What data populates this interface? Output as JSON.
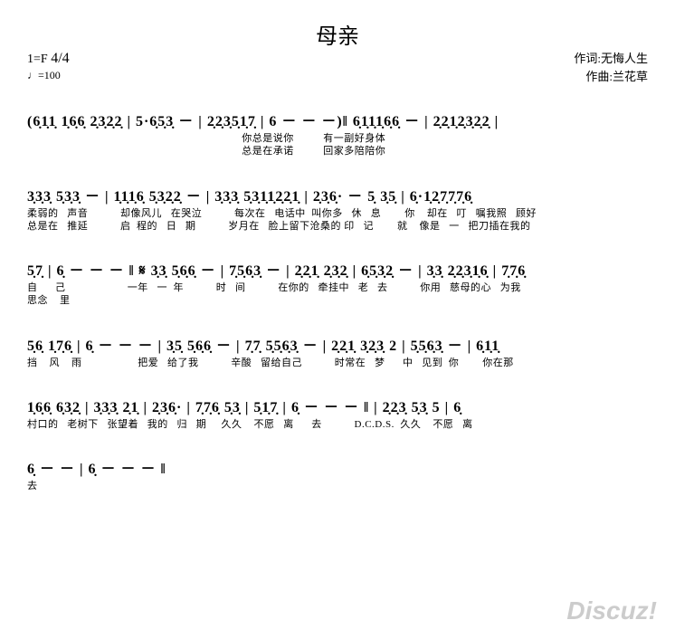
{
  "title": "母亲",
  "credits": {
    "lyricist_label": "作词:无悔人生",
    "composer_label": "作曲:兰花草"
  },
  "meta": {
    "key": "1=F",
    "time_sig": "4/4",
    "tempo": "♩=100"
  },
  "lines": [
    {
      "notes": "(6̣1̣1̣ 1̣6̣6̣ 2̣3̣2̣2̣ | 5·6̣5̣3̣ － | 2̣2̣3̣5̣1̣7̣ | 6 － － －)‖ 6̣1̣1̣1̣6̣6̣ － | 2̣2̣1̣2̣3̣2̣2̣ |",
      "lyrics1": "                                                                         你总是说你          有一副好身体",
      "lyrics2": "                                                                         总是在承诺          回家多陪陪你"
    },
    {
      "notes": "3̣3̣3̣ 5̣3̣3̣ － | 1̣1̣1̣6̣ 5̣3̣2̣2̣ － | 3̣3̣3̣ 5̣3̣1̣1̣2̣2̣1̣ | 2̣3̣6̣· － 5̣ 3̣5̣ | 6̣·1̣2̣7̣7̣7̣6̣",
      "lyrics1": "柔弱的   声音           却像风儿   在哭泣           每次在   电话中  叫你多   休   息        你    却在   叮   嘱我照   顾好",
      "lyrics2": "总是在   推延           启  程的   日   期           岁月在   脸上留下沧桑的 印   记        就    像是   一   把刀插在我的"
    },
    {
      "notes": "5̣7̣ | 6̣ － － － ‖ 𝄋 3̣3̣ 5̣6̣6̣ － | 7̣5̣6̣3̣ － | 2̣2̣1̣ 2̣3̣2̣ | 6̣5̣3̣2̣ － | 3̣3̣ 2̣2̣3̣1̣6̣ | 7̣7̣6̣",
      "lyrics1": "自      己                     一年   一  年           时   间           在你的   牵挂中   老   去           你用   慈母的心   为我",
      "lyrics2": "思念    里"
    },
    {
      "notes": "5̣6̣ 1̣7̣6̣ | 6̣ － － － | 3̣5̣ 5̣6̣6̣ － | 7̣7̣ 5̣5̣6̣3̣ － | 2̣2̣1̣ 3̣2̣3̣ 2 | 5̣5̣6̣3̣ － | 6̣1̣1̣",
      "lyrics1": "挡    风    雨                   把爱   给了我           辛酸   留给自己           时常在   梦      中   见到  你        你在那",
      "lyrics2": ""
    },
    {
      "notes": "1̣6̣6̣ 6̣3̣2̣ | 3̣3̣3̣ 2̣1̣ | 2̣3̣6̣· | 7̣7̣6̣ 5̣3̣ | 5̣1̣7̣ | 6̣ － － － ‖       | 2̣2̣3̣ 5̣3̣ 5 | 6̣",
      "lyrics1": "村口的   老树下   张望着   我的   归   期     久久    不愿   离      去           D.C.D.S.  久久    不愿   离",
      "lyrics2": ""
    },
    {
      "notes": "6̣ － － | 6̣ － － － ‖",
      "lyrics1": "去",
      "lyrics2": ""
    }
  ],
  "watermark": "Discuz!"
}
